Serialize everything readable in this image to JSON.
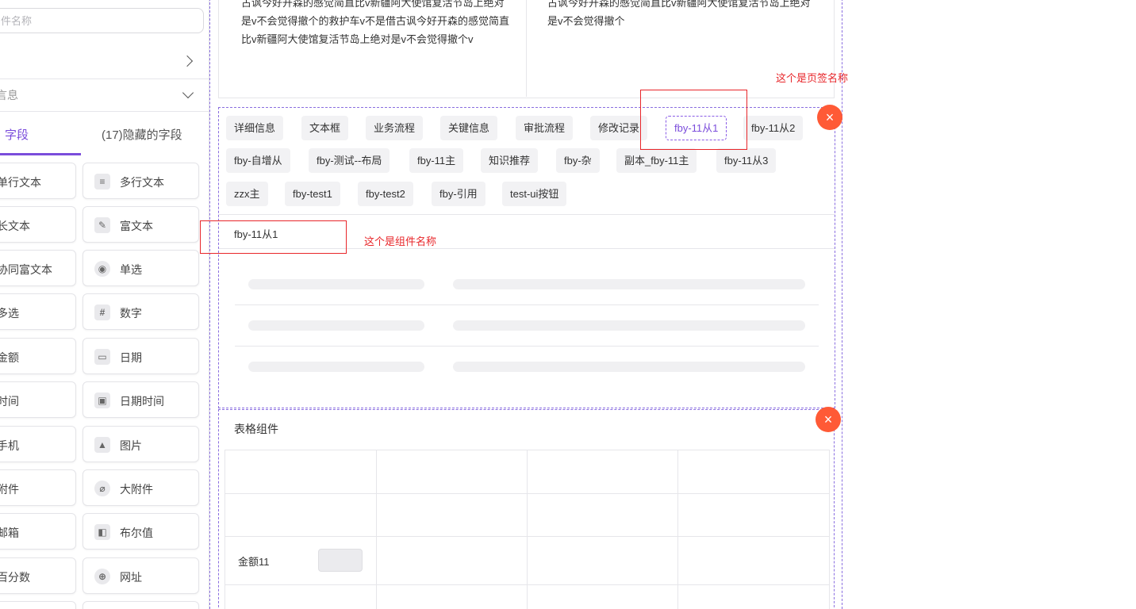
{
  "sidebar": {
    "search_placeholder": "件名称",
    "expanded_section_label": "言息",
    "tabs": {
      "visible": "字段",
      "hidden": "(17)隐藏的字段"
    },
    "fields_left": [
      "单行文本",
      "长文本",
      "协同富文本",
      "多选",
      "金额",
      "时间",
      "手机",
      "附件",
      "邮箱",
      "百分数"
    ],
    "fields_right": [
      {
        "label": "多行文本",
        "icon": "multiline-text-icon",
        "glyph": "≡"
      },
      {
        "label": "富文本",
        "icon": "rich-text-icon",
        "glyph": "✎"
      },
      {
        "label": "单选",
        "icon": "radio-icon",
        "glyph": "◉"
      },
      {
        "label": "数字",
        "icon": "number-icon",
        "glyph": "#"
      },
      {
        "label": "日期",
        "icon": "date-icon",
        "glyph": "▭"
      },
      {
        "label": "日期时间",
        "icon": "datetime-icon",
        "glyph": "▣"
      },
      {
        "label": "图片",
        "icon": "image-icon",
        "glyph": "▲"
      },
      {
        "label": "大附件",
        "icon": "attachment-icon",
        "glyph": "⌀"
      },
      {
        "label": "布尔值",
        "icon": "boolean-icon",
        "glyph": "◧"
      },
      {
        "label": "网址",
        "icon": "globe-icon",
        "glyph": "⊕"
      }
    ]
  },
  "top_card": {
    "left_text": "古讽今好开森的感觉简直比v新疆阿大使馆复活节岛上绝对是v不会觉得撤个的救护车v不是借古讽今好开森的感觉简直比v新疆阿大使馆复活节岛上绝对是v不会觉得撤个v",
    "right_text": "古讽今好开森的感觉简直比v新疆阿大使馆复活节岛上绝对是v不会觉得撤个"
  },
  "tab_component": {
    "tabs": [
      "详细信息",
      "文本框",
      "业务流程",
      "关键信息",
      "审批流程",
      "修改记录",
      "fby-11从1",
      "fby-11从2",
      "fby-自增从",
      "fby-测试--布局",
      "fby-11主",
      "知识推荐",
      "fby-杂",
      "副本_fby-11主",
      "fby-11从3",
      "zzx主",
      "fby-test1",
      "fby-test2",
      "fby-引用",
      "test-ui按钮"
    ],
    "active_tab": "fby-11从1",
    "component_name": "fby-11从1",
    "close_glyph": "×"
  },
  "table_component": {
    "title": "表格组件",
    "field_label": "金额11",
    "close_glyph": "×"
  },
  "annotations": {
    "tab_name": "这个是页签名称",
    "component_name": "这个是组件名称"
  },
  "colors": {
    "accent": "#7b4ddb",
    "annotation_red": "#e8262a",
    "close_orange": "#ff5a36"
  }
}
